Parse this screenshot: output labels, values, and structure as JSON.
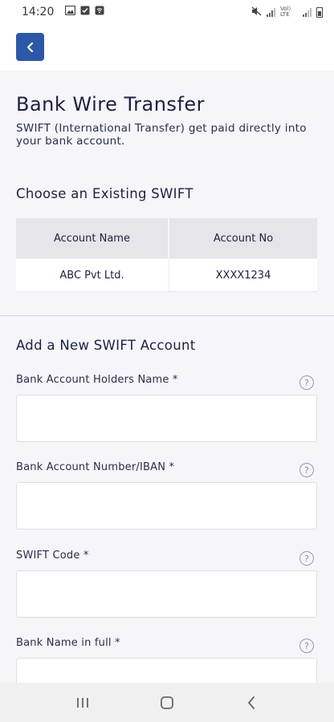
{
  "status_bar": {
    "time": "14:20",
    "network": "Vol) LTE",
    "network_sub": "LTE2"
  },
  "header": {
    "back_icon": "chevron-left-icon",
    "accent_color": "#2c58a7"
  },
  "page": {
    "title": "Bank Wire Transfer",
    "subtitle": "SWIFT (International Transfer) get paid directly into your bank account."
  },
  "existing": {
    "title": "Choose an Existing SWIFT",
    "columns": [
      "Account Name",
      "Account No"
    ],
    "rows": [
      {
        "name": "ABC Pvt Ltd.",
        "number": "XXXX1234"
      }
    ]
  },
  "new_account": {
    "title": "Add a New SWIFT Account",
    "fields": [
      {
        "label": "Bank Account  Holders Name *",
        "value": ""
      },
      {
        "label": "Bank Account  Number/IBAN *",
        "value": ""
      },
      {
        "label": "SWIFT Code *",
        "value": ""
      },
      {
        "label": "Bank Name in full *",
        "value": ""
      }
    ],
    "help_glyph": "?"
  },
  "nav": {
    "recents_icon": "recents-icon",
    "home_icon": "home-icon",
    "back_icon": "back-icon"
  }
}
